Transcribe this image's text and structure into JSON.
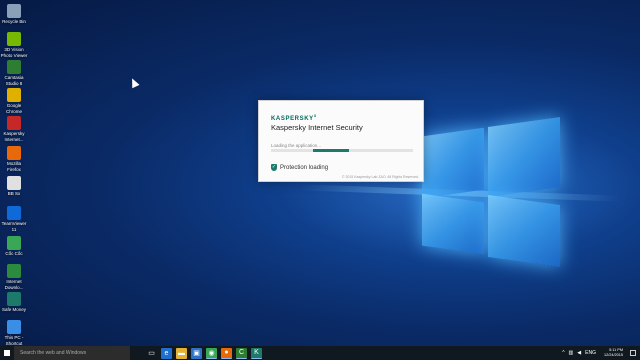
{
  "desktop": {
    "icons": [
      {
        "label": "Recycle Bin",
        "icon": "recycle-bin-icon",
        "color": "#8aa0b8"
      },
      {
        "label": "3D Vision Photo Viewer",
        "icon": "3d-vision-icon",
        "color": "#76b900"
      },
      {
        "label": "Camtasia Studio 8",
        "icon": "camtasia-icon",
        "color": "#2e7d32"
      },
      {
        "label": "Google Chrome",
        "icon": "chrome-icon",
        "color": "#e0b000"
      },
      {
        "label": "Kaspersky Internet...",
        "icon": "kaspersky-icon",
        "color": "#c62828"
      },
      {
        "label": "Mozilla Firefox",
        "icon": "firefox-icon",
        "color": "#e8690a"
      },
      {
        "label": "BB Sx",
        "icon": "document-icon",
        "color": "#e0e0e0"
      },
      {
        "label": "TeamViewer 11",
        "icon": "teamviewer-icon",
        "color": "#0e6ad8"
      },
      {
        "label": "Cốc Cốc",
        "icon": "coccoc-icon",
        "color": "#3aa757"
      },
      {
        "label": "Internet Downlo...",
        "icon": "idm-icon",
        "color": "#2b8a3e"
      },
      {
        "label": "Safe Money",
        "icon": "safe-money-icon",
        "color": "#1d7a6a"
      },
      {
        "label": "This PC - Shortcut",
        "icon": "this-pc-icon",
        "color": "#3a8ee6"
      }
    ]
  },
  "splash": {
    "logo_text": "KASPERSKY",
    "logo_suffix": "3",
    "product_name": "Kaspersky Internet Security",
    "loading_text": "Loading the application...",
    "progress_fill": 0.25,
    "protection_text": "Protection loading",
    "copyright": "© 2015 Kaspersky Lab ZAO. All Rights Reserved."
  },
  "taskbar": {
    "search_placeholder": "Search the web and Windows",
    "apps": [
      {
        "icon": "task-view-icon",
        "glyph": "▭",
        "color": "#101820"
      },
      {
        "icon": "edge-icon",
        "glyph": "e",
        "color": "#1e6fd0"
      },
      {
        "icon": "file-explorer-icon",
        "glyph": "▬",
        "color": "#e5b334"
      },
      {
        "icon": "store-icon",
        "glyph": "▣",
        "color": "#2d72c4"
      },
      {
        "icon": "chrome-icon",
        "glyph": "◉",
        "color": "#3aa757"
      },
      {
        "icon": "firefox-icon",
        "glyph": "●",
        "color": "#e8690a"
      },
      {
        "icon": "camtasia-icon",
        "glyph": "C",
        "color": "#2e7d32"
      },
      {
        "icon": "kaspersky-icon",
        "glyph": "K",
        "color": "#1d7a6a"
      }
    ],
    "tray": {
      "chevron": "^",
      "language": "ENG",
      "time": "5:11 PM",
      "date": "12/24/2015"
    }
  }
}
